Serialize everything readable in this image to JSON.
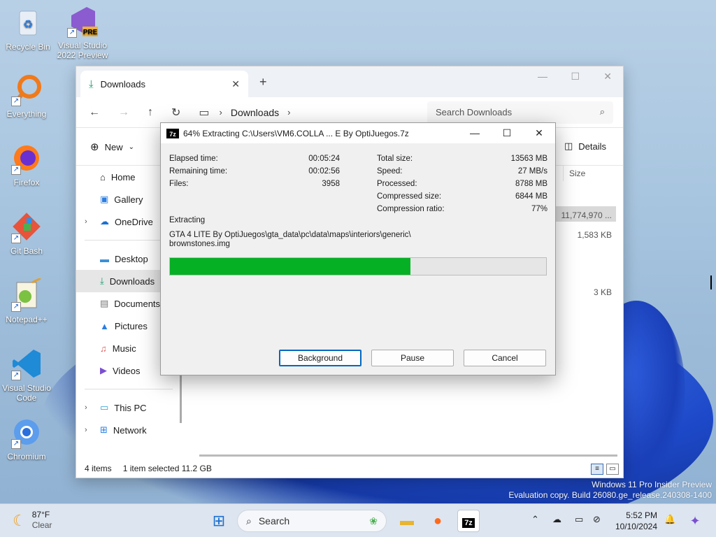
{
  "desktop": {
    "icons": [
      {
        "label": "Recycle Bin",
        "icon": "recycle-bin-icon"
      },
      {
        "label": "Visual Studio 2022 Preview",
        "icon": "visual-studio-preview-icon",
        "badge": "PRE"
      },
      {
        "label": "Everything",
        "icon": "everything-search-icon"
      },
      {
        "label": "Firefox",
        "icon": "firefox-icon"
      },
      {
        "label": "Git Bash",
        "icon": "git-bash-icon"
      },
      {
        "label": "Notepad++",
        "icon": "notepad-plus-plus-icon"
      },
      {
        "label": "Visual Studio Code",
        "icon": "vscode-icon"
      },
      {
        "label": "Chromium",
        "icon": "chromium-icon"
      }
    ],
    "watermark_line1": "Windows 11 Pro Insider Preview",
    "watermark_line2": "Evaluation copy. Build 26080.ge_release.240308-1400"
  },
  "explorer": {
    "tab_label": "Downloads",
    "tab_close": "✕",
    "new_tab": "+",
    "breadcrumb": "Downloads",
    "search_placeholder": "Search Downloads",
    "cmd_new": "New",
    "cmd_details": "Details",
    "column_size": "Size",
    "sizes": [
      "11,774,970 ...",
      "1,583 KB",
      "3 KB"
    ],
    "sidebar": [
      {
        "label": "Home",
        "icon": "home-icon"
      },
      {
        "label": "Gallery",
        "icon": "gallery-icon"
      },
      {
        "label": "OneDrive",
        "icon": "onedrive-icon"
      },
      {
        "label": "Desktop",
        "icon": "desktop-folder-icon"
      },
      {
        "label": "Downloads",
        "icon": "downloads-icon"
      },
      {
        "label": "Documents",
        "icon": "documents-icon"
      },
      {
        "label": "Pictures",
        "icon": "pictures-icon"
      },
      {
        "label": "Music",
        "icon": "music-icon"
      },
      {
        "label": "Videos",
        "icon": "videos-icon"
      },
      {
        "label": "This PC",
        "icon": "this-pc-icon"
      },
      {
        "label": "Network",
        "icon": "network-icon"
      }
    ],
    "status_items": "4 items",
    "status_selected": "1 item selected  11.2 GB"
  },
  "dialog": {
    "logo": "7z",
    "title": "64% Extracting C:\\Users\\VM6.COLLA ... E By OptiJuegos.7z",
    "left_stats": [
      {
        "label": "Elapsed time:",
        "value": "00:05:24"
      },
      {
        "label": "Remaining time:",
        "value": "00:02:56"
      },
      {
        "label": "Files:",
        "value": "3958"
      }
    ],
    "right_stats": [
      {
        "label": "Total size:",
        "value": "13563 MB"
      },
      {
        "label": "Speed:",
        "value": "27 MB/s"
      },
      {
        "label": "Processed:",
        "value": "8788 MB"
      },
      {
        "label": "Compressed size:",
        "value": "6844 MB"
      },
      {
        "label": "Compression ratio:",
        "value": "77%"
      }
    ],
    "extracting_label": "Extracting",
    "path_line1": "GTA 4 LITE By OptiJuegos\\gta_data\\pc\\data\\maps\\interiors\\generic\\",
    "path_line2": "brownstones.img",
    "progress_fraction": 0.64,
    "progress_color": "#06b025",
    "buttons": {
      "background": "Background",
      "pause": "Pause",
      "cancel": "Cancel"
    }
  },
  "taskbar": {
    "temperature": "87°F",
    "condition": "Clear",
    "search_label": "Search",
    "time": "5:52 PM",
    "date": "10/10/2024",
    "apps": [
      "start-icon",
      "file-explorer-icon",
      "firefox-icon",
      "7zip-icon"
    ]
  }
}
